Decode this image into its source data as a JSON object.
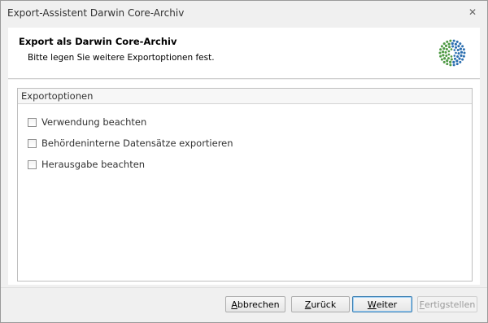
{
  "window": {
    "title": "Export-Assistent Darwin Core-Archiv",
    "close_glyph": "✕"
  },
  "header": {
    "title": "Export als Darwin Core-Archiv",
    "description": "Bitte legen Sie weitere Exportoptionen fest."
  },
  "options_group": {
    "label": "Exportoptionen",
    "items": [
      {
        "label": "Verwendung beachten",
        "checked": false
      },
      {
        "label": "Behördeninterne Datensätze exportieren",
        "checked": false
      },
      {
        "label": "Herausgabe beachten",
        "checked": false
      }
    ]
  },
  "buttons": {
    "cancel": {
      "mnemonic": "A",
      "rest": "bbrechen"
    },
    "back": {
      "mnemonic": "Z",
      "rest": "urück"
    },
    "next": {
      "mnemonic": "W",
      "rest": "eiter"
    },
    "finish": {
      "mnemonic": "F",
      "rest": "ertigstellen"
    }
  },
  "colors": {
    "logo_green": "#4f9a45",
    "logo_blue": "#2c6fb0"
  },
  "icons": {
    "logo": "dotted-globe-logo-icon",
    "close": "close-icon"
  }
}
